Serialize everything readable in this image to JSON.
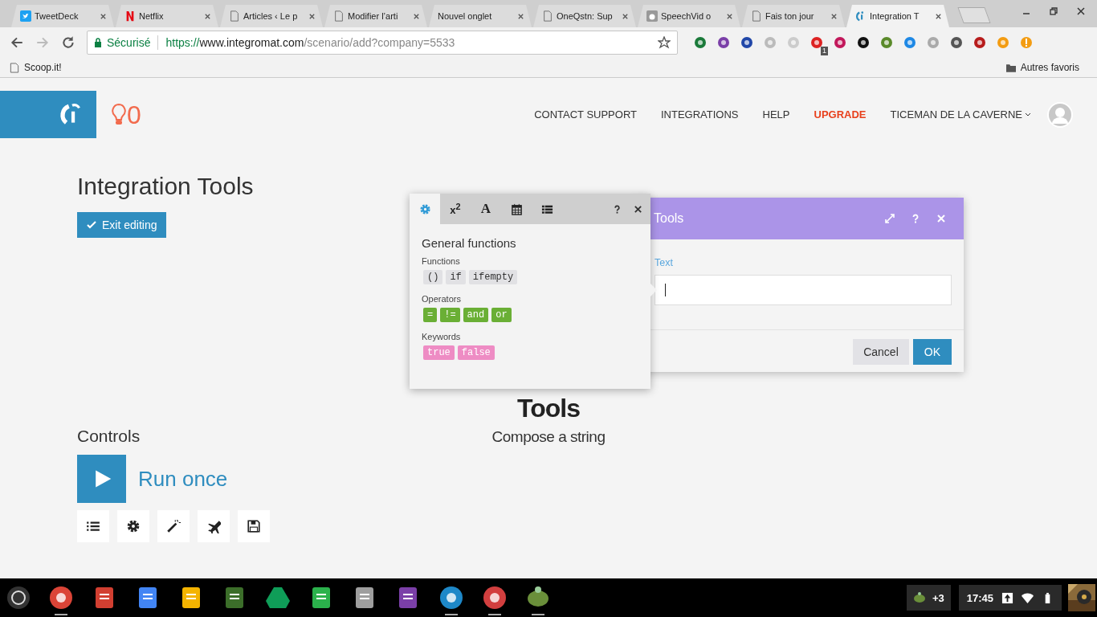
{
  "browser": {
    "tabs": [
      {
        "title": "TweetDeck",
        "kind": "bird",
        "selected": false
      },
      {
        "title": "Netflix",
        "kind": "letter",
        "selected": false
      },
      {
        "title": "Articles ‹ Le p",
        "kind": "page",
        "selected": false
      },
      {
        "title": "Modifier l’arti",
        "kind": "page",
        "selected": false
      },
      {
        "title": "Nouvel onglet",
        "kind": "blank",
        "selected": false
      },
      {
        "title": "OneQstn: Sup",
        "kind": "page",
        "selected": false
      },
      {
        "title": "SpeechVid o",
        "kind": "apple",
        "selected": false
      },
      {
        "title": "Fais ton jour",
        "kind": "page",
        "selected": false
      },
      {
        "title": "Integration T",
        "kind": "brand",
        "selected": true
      }
    ],
    "address": {
      "security": "Sécurisé",
      "scheme": "https://",
      "host": "www.integromat.com",
      "path": "/scenario/add?company=5533",
      "starred": false
    },
    "extension_badge": "1",
    "bookmarks": [
      {
        "label": "Scoop.it!"
      }
    ],
    "other_bookmarks": "Autres favoris"
  },
  "header": {
    "notification_count": "0",
    "nav": [
      {
        "label": "CONTACT SUPPORT",
        "highlighted": false,
        "dropdown": false
      },
      {
        "label": "INTEGRATIONS",
        "highlighted": false,
        "dropdown": false
      },
      {
        "label": "HELP",
        "highlighted": false,
        "dropdown": false
      },
      {
        "label": "UPGRADE",
        "highlighted": true,
        "dropdown": false
      },
      {
        "label": "TICEMAN DE LA CAVERNE",
        "highlighted": false,
        "dropdown": true
      }
    ]
  },
  "scenario": {
    "title": "Integration Tools",
    "exit_button": "Exit editing"
  },
  "module": {
    "name": "Tools",
    "description": "Compose a string"
  },
  "function_panel": {
    "tabs": [
      {
        "kind": "general",
        "selected": true
      },
      {
        "kind": "math",
        "label": "x$^{2}$",
        "selected": false
      },
      {
        "kind": "text",
        "label": "A",
        "selected": false
      },
      {
        "kind": "date",
        "selected": false
      },
      {
        "kind": "array",
        "selected": false
      }
    ],
    "heading": "General functions",
    "groups": [
      {
        "title": "Functions",
        "kind": "function",
        "items": [
          "()",
          "if",
          "ifempty"
        ]
      },
      {
        "title": "Operators",
        "kind": "operator",
        "items": [
          "=",
          "!=",
          "and",
          "or"
        ]
      },
      {
        "title": "Keywords",
        "kind": "keyword",
        "items": [
          "true",
          "false"
        ]
      }
    ]
  },
  "dialog": {
    "title": "Tools",
    "field_label": "Text",
    "focused": true,
    "buttons": [
      {
        "label": "Cancel",
        "kind": "secondary"
      },
      {
        "label": "OK",
        "kind": "primary"
      }
    ]
  },
  "controls": {
    "heading": "Controls",
    "run_label": "Run once",
    "tools": [
      {
        "kind": "list"
      },
      {
        "kind": "gear"
      },
      {
        "kind": "wand"
      },
      {
        "kind": "plane"
      },
      {
        "kind": "save"
      }
    ]
  },
  "taskbar": {
    "apps": [
      {
        "kind": "chrome",
        "running": true
      },
      {
        "kind": "mail",
        "running": false
      },
      {
        "kind": "docs",
        "running": false
      },
      {
        "kind": "slides",
        "running": false
      },
      {
        "kind": "terminal",
        "running": false
      },
      {
        "kind": "drive",
        "running": false
      },
      {
        "kind": "feedly",
        "running": false
      },
      {
        "kind": "store",
        "running": false
      },
      {
        "kind": "onenote",
        "running": false
      },
      {
        "kind": "files",
        "running": true
      },
      {
        "kind": "gallery",
        "running": true
      },
      {
        "kind": "turtle",
        "running": true
      }
    ],
    "tray_count": "+3",
    "time": "17:45"
  }
}
